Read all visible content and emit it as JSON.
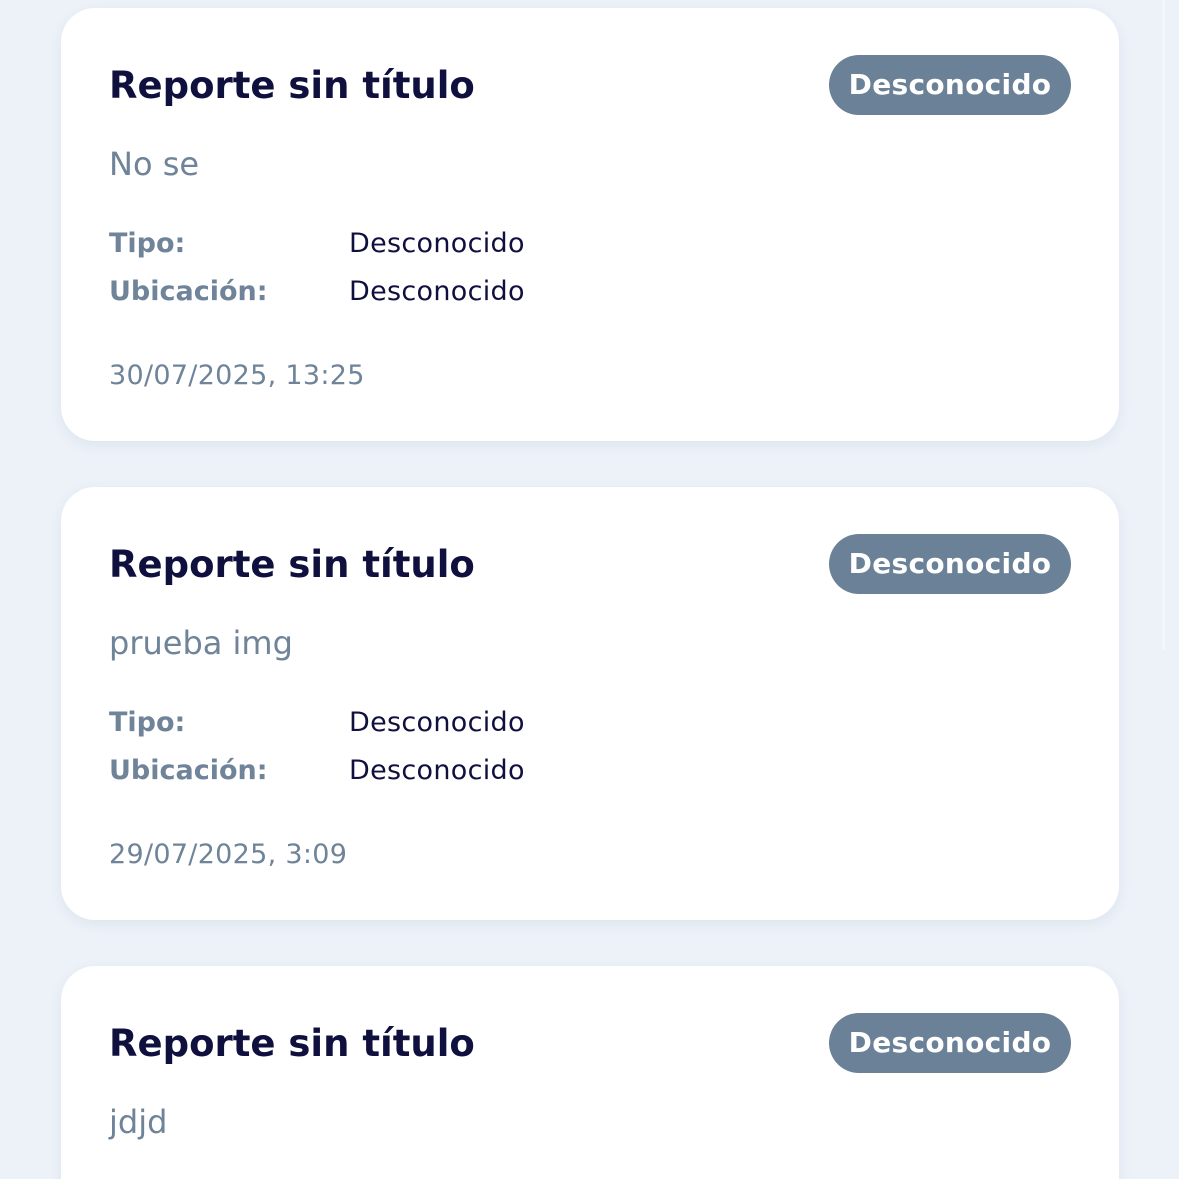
{
  "reports": [
    {
      "title": "Reporte sin título",
      "status": "Desconocido",
      "description": "No se",
      "type_label": "Tipo:",
      "type_value": "Desconocido",
      "location_label": "Ubicación:",
      "location_value": "Desconocido",
      "date": "30/07/2025, 13:25"
    },
    {
      "title": "Reporte sin título",
      "status": "Desconocido",
      "description": "prueba img",
      "type_label": "Tipo:",
      "type_value": "Desconocido",
      "location_label": "Ubicación:",
      "location_value": "Desconocido",
      "date": "29/07/2025, 3:09"
    },
    {
      "title": "Reporte sin título",
      "status": "Desconocido",
      "description": "jdjd"
    }
  ],
  "colors": {
    "page_background": "#edf2f9",
    "card_background": "#ffffff",
    "title_text": "#10103f",
    "muted_text": "#6f8399",
    "status_badge": "#6b8197"
  }
}
